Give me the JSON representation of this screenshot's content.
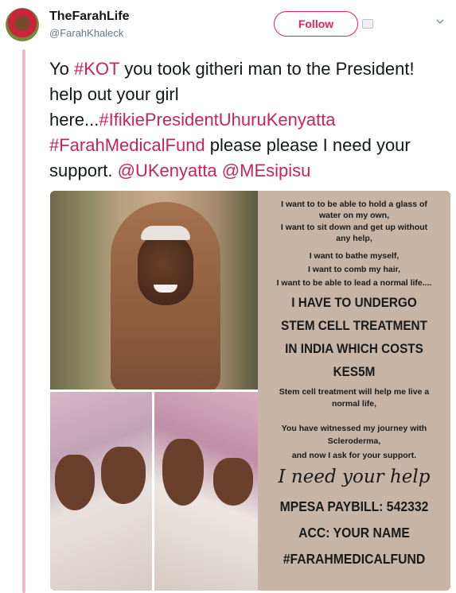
{
  "account": {
    "display_name": "TheFarahLife",
    "handle": "@FarahKhaleck",
    "follow_label": "Follow"
  },
  "tweet": {
    "seg1": "Yo ",
    "seg2": "#KOT",
    "seg3": " you took githeri man to the President! help out your girl here...",
    "seg4": "#IfikiePresidentUhuruKenyatta",
    "seg5": " ",
    "seg6": "#FarahMedicalFund",
    "seg7": " please please I need your support. ",
    "seg8": "@UKenyatta",
    "seg9": " ",
    "seg10": "@MEsipisu"
  },
  "flyer": {
    "intro_lines": [
      "I want to to be able to hold a glass of",
      "water on my own,",
      "I want to sit down and get up without",
      "any help,",
      "I want to bathe myself,",
      "I want to comb my hair,",
      "I want to be able to lead a normal life...."
    ],
    "headline_lines": [
      "I HAVE TO UNDERGO",
      "STEM CELL TREATMENT",
      "IN INDIA WHICH COSTS",
      "KES5M"
    ],
    "body_lines_1": [
      "Stem cell treatment will help me live a",
      "normal life,"
    ],
    "body_lines_2": [
      "You have witnessed my journey with",
      "Scleroderma,",
      "and now I ask for your support."
    ],
    "script_line": "I need your help",
    "plea_lines": [
      "MPESA PAYBILL: 542332",
      "ACC: YOUR NAME",
      "#FARAHMEDICALFUND"
    ]
  },
  "colors": {
    "accent": "#e0245e",
    "hashtag": "#c6245e",
    "thread_line": "#f2b5ca",
    "flyer_bg": "#c7b4a5"
  },
  "icons": {
    "caret": "chevron-down-icon",
    "follow_badge": "card-icon"
  }
}
